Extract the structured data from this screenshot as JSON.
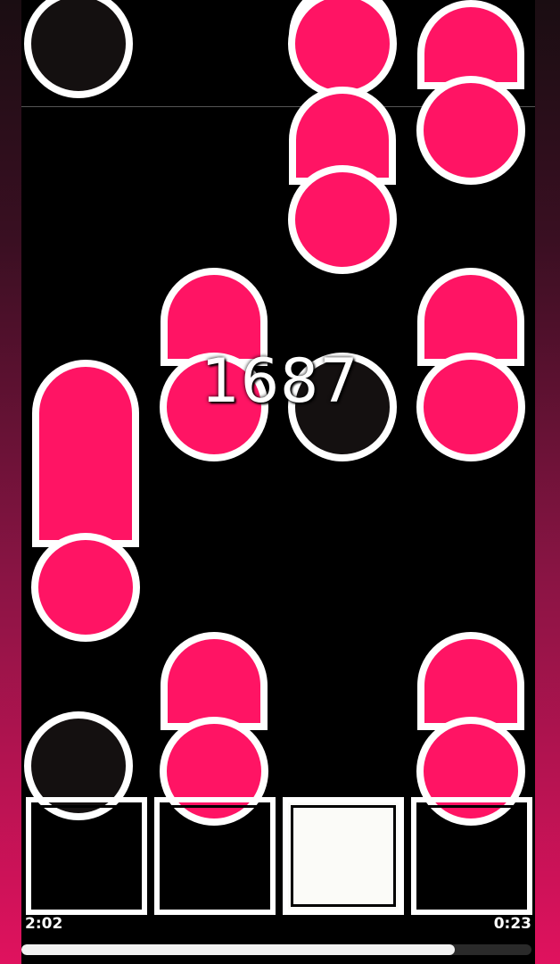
{
  "game": {
    "score": "1687",
    "elapsed_time": "2:02",
    "remaining_time": "0:23",
    "progress_fraction": 0.85,
    "colors": {
      "note_pink": "#ff1464",
      "note_dark": "#141010",
      "outline": "#ffffff",
      "background": "#000000"
    },
    "lanes": 4,
    "active_key_lane": 3
  }
}
